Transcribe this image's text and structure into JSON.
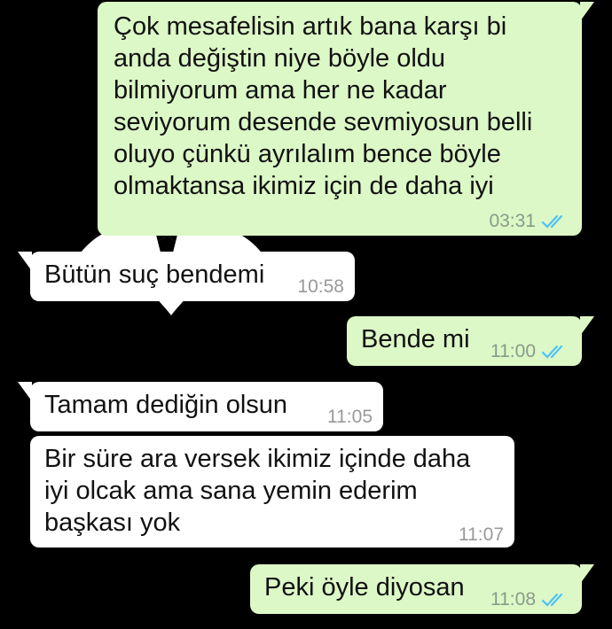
{
  "messages": [
    {
      "direction": "outgoing",
      "text": "Çok mesafelisin artık bana karşı bi\nanda değiştin niye böyle oldu\nbilmiyorum ama her ne kadar\nseviyorum desende sevmiyosun belli\noluyo çünkü ayrılalım bence böyle\nolmaktansa ikimiz için de daha iyi",
      "time": "03:31",
      "status": "read"
    },
    {
      "direction": "incoming",
      "text": "Bütün suç bendemi",
      "time": "10:58"
    },
    {
      "direction": "outgoing",
      "text": "Bende mi",
      "time": "11:00",
      "status": "read"
    },
    {
      "direction": "incoming",
      "text": "Tamam dediğin olsun",
      "time": "11:05"
    },
    {
      "direction": "incoming",
      "text": "Bir süre ara versek ikimiz içinde daha\niyi olcak ama sana yemin ederim\nbaşkası yok",
      "time": "11:07"
    },
    {
      "direction": "outgoing",
      "text": "Peki öyle diyosan",
      "time": "11:08",
      "status": "read"
    }
  ],
  "colors": {
    "background": "#000000",
    "outgoing_bubble": "#dcf8c6",
    "incoming_bubble": "#ffffff",
    "read_ticks": "#4fc3f7"
  },
  "icons": {
    "read_receipt": "double-check-icon"
  }
}
